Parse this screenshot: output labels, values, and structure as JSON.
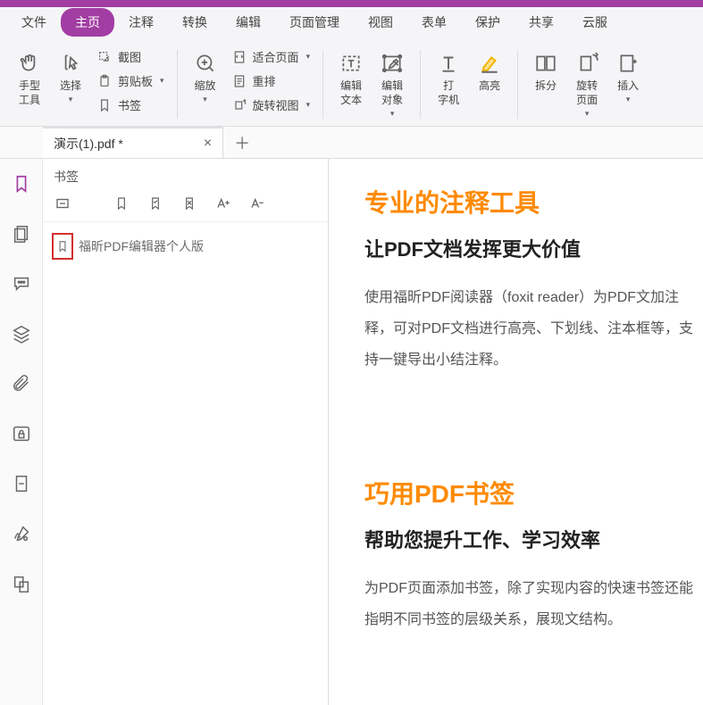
{
  "menu": {
    "items": [
      "文件",
      "主页",
      "注释",
      "转换",
      "编辑",
      "页面管理",
      "视图",
      "表单",
      "保护",
      "共享",
      "云服"
    ],
    "active_index": 1
  },
  "ribbon": {
    "hand": "手型\n工具",
    "select": "选择",
    "screenshot": "截图",
    "clipboard": "剪贴板",
    "bookmark": "书签",
    "zoom": "缩放",
    "fit_page": "适合页面",
    "reflow": "重排",
    "rotate_view": "旋转视图",
    "edit_text": "编辑\n文本",
    "edit_object": "编辑\n对象",
    "typewriter": "打\n字机",
    "highlight": "高亮",
    "split": "拆分",
    "rotate_page": "旋转\n页面",
    "insert": "插入"
  },
  "tab": {
    "name": "演示(1).pdf *"
  },
  "panel": {
    "title": "书签",
    "item": "福昕PDF编辑器个人版"
  },
  "doc": {
    "s1_h1": "专业的注释工具",
    "s1_h2": "让PDF文档发挥更大价值",
    "s1_p": "使用福昕PDF阅读器（foxit reader）为PDF文加注释，可对PDF文档进行高亮、下划线、注本框等，支持一键导出小结注释。",
    "s2_h1": "巧用PDF书签",
    "s2_h2": "帮助您提升工作、学习效率",
    "s2_p": "为PDF页面添加书签，除了实现内容的快速书签还能指明不同书签的层级关系，展现文结构。"
  }
}
